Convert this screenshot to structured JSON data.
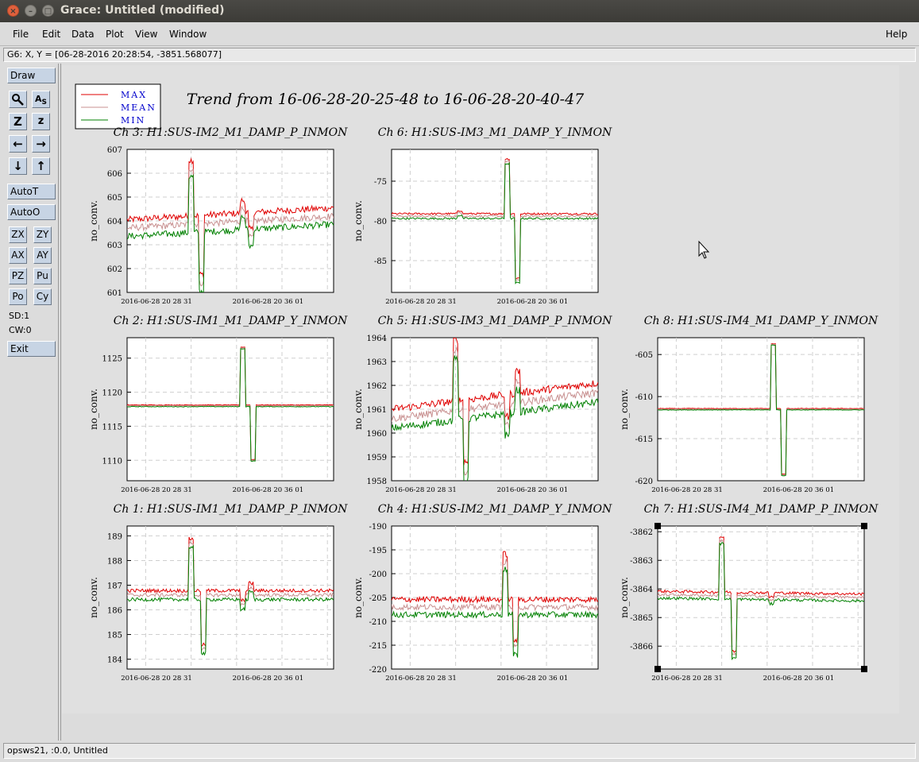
{
  "window": {
    "title": "Grace: Untitled (modified)"
  },
  "menu": {
    "file": "File",
    "edit": "Edit",
    "data": "Data",
    "plot": "Plot",
    "view": "View",
    "window": "Window",
    "help": "Help"
  },
  "coord_readout": "G6: X, Y = [06-28-2016 20:28:54, -3851.568077]",
  "tools": {
    "draw": "Draw",
    "autot": "AutoT",
    "autoo": "AutoO",
    "zx": "ZX",
    "zy": "ZY",
    "ax": "AX",
    "ay": "AY",
    "pz": "PZ",
    "pu": "Pu",
    "po": "Po",
    "cy": "Cy",
    "sd": "SD:1",
    "cw": "CW:0",
    "exit": "Exit",
    "icons": [
      "zoom-icon",
      "text-icon",
      "autoscale-z-icon",
      "zoom-z-icon",
      "left-arrow-icon",
      "right-arrow-icon",
      "down-arrow-icon",
      "up-arrow-icon"
    ]
  },
  "status": "opsws21, :0.0, Untitled",
  "plot_title": "Trend from 16-06-28-20-25-48 to 16-06-28-20-40-47",
  "legend": [
    "MAX",
    "MEAN",
    "MIN"
  ],
  "colors": {
    "max": "#e00000",
    "mean": "#c89090",
    "min": "#008000",
    "legend_text": "#0000cc"
  },
  "chart_data": [
    {
      "type": "line",
      "title": "Ch 3: H1:SUS-IM2_M1_DAMP_P_INMON",
      "ylabel": "no_conv.",
      "ylim": [
        601,
        607
      ],
      "yticks": [
        "601",
        "602",
        "603",
        "604",
        "605",
        "606",
        "607"
      ],
      "xticks": [
        "2016-06-28 20 28 31",
        "2016-06-28 20 36 01"
      ],
      "shape": "drift_spike",
      "base": [
        603.7,
        604.2
      ],
      "spread": [
        0.35,
        0.25
      ],
      "events": [
        {
          "t": 0.31,
          "v": 606.2
        },
        {
          "t": 0.36,
          "v": 601.4
        },
        {
          "t": 0.56,
          "v": 604.5
        },
        {
          "t": 0.6,
          "v": 603.3
        }
      ],
      "series": [
        {
          "name": "MAX"
        },
        {
          "name": "MEAN"
        },
        {
          "name": "MIN"
        }
      ]
    },
    {
      "type": "line",
      "title": "Ch 6: H1:SUS-IM3_M1_DAMP_Y_INMON",
      "ylabel": "no_conv.",
      "ylim": [
        -89,
        -71
      ],
      "yticks": [
        "-75",
        "-80",
        "-85"
      ],
      "yvals": [
        -75,
        -80,
        -85
      ],
      "xticks": [
        "2016-06-28 20 28 31",
        "2016-06-28 20 36 01"
      ],
      "shape": "flat_spike",
      "base": [
        -79.4,
        -79.4
      ],
      "spread": [
        0.3,
        0.2
      ],
      "events": [
        {
          "t": 0.33,
          "v": -79.0
        },
        {
          "t": 0.56,
          "v": -72.5
        },
        {
          "t": 0.61,
          "v": -87.5
        }
      ],
      "series": [
        {
          "name": "MAX"
        },
        {
          "name": "MEAN"
        },
        {
          "name": "MIN"
        }
      ]
    },
    {
      "type": "line",
      "title": "Ch 2: H1:SUS-IM1_M1_DAMP_Y_INMON",
      "ylabel": "no_conv.",
      "ylim": [
        1107,
        1128
      ],
      "yticks": [
        "1110",
        "1115",
        "1120",
        "1125"
      ],
      "yvals": [
        1110,
        1115,
        1120,
        1125
      ],
      "xticks": [
        "2016-06-28 20 28 31",
        "2016-06-28 20 36 01"
      ],
      "shape": "flat_spike",
      "base": [
        1118,
        1118
      ],
      "spread": [
        0.12,
        0.08
      ],
      "events": [
        {
          "t": 0.56,
          "v": 1126.5
        },
        {
          "t": 0.61,
          "v": 1110
        }
      ],
      "series": [
        {
          "name": "MAX"
        },
        {
          "name": "MEAN"
        },
        {
          "name": "MIN"
        }
      ]
    },
    {
      "type": "line",
      "title": "Ch 5: H1:SUS-IM3_M1_DAMP_P_INMON",
      "ylabel": "no_conv.",
      "ylim": [
        1958,
        1964
      ],
      "yticks": [
        "1958",
        "1959",
        "1960",
        "1961",
        "1962",
        "1963",
        "1964"
      ],
      "xticks": [
        "2016-06-28 20 28 31",
        "2016-06-28 20 36 01"
      ],
      "shape": "drift_spike",
      "base": [
        1960.6,
        1961.7
      ],
      "spread": [
        0.4,
        0.3
      ],
      "events": [
        {
          "t": 0.31,
          "v": 1963.5
        },
        {
          "t": 0.36,
          "v": 1958.4
        },
        {
          "t": 0.56,
          "v": 1960.3
        },
        {
          "t": 0.61,
          "v": 1962.2
        }
      ],
      "series": [
        {
          "name": "MAX"
        },
        {
          "name": "MEAN"
        },
        {
          "name": "MIN"
        }
      ]
    },
    {
      "type": "line",
      "title": "Ch 8: H1:SUS-IM4_M1_DAMP_Y_INMON",
      "ylabel": "no_conv.",
      "ylim": [
        -620,
        -603
      ],
      "yticks": [
        "-605",
        "-610",
        "-615",
        "-620"
      ],
      "yvals": [
        -605,
        -610,
        -615,
        -620
      ],
      "xticks": [
        "2016-06-28 20 28 31",
        "2016-06-28 20 36 01"
      ],
      "shape": "flat_spike",
      "base": [
        -611.5,
        -611.5
      ],
      "spread": [
        0.08,
        0.06
      ],
      "events": [
        {
          "t": 0.56,
          "v": -603.8
        },
        {
          "t": 0.61,
          "v": -619.3
        }
      ],
      "series": [
        {
          "name": "MAX"
        },
        {
          "name": "MEAN"
        },
        {
          "name": "MIN"
        }
      ]
    },
    {
      "type": "line",
      "title": "Ch 1: H1:SUS-IM1_M1_DAMP_P_INMON",
      "ylabel": "no_conv.",
      "ylim": [
        183.6,
        189.4
      ],
      "yticks": [
        "184",
        "185",
        "186",
        "187",
        "188",
        "189"
      ],
      "yvals": [
        184,
        185,
        186,
        187,
        188,
        189
      ],
      "xticks": [
        "2016-06-28 20 28 31",
        "2016-06-28 20 36 01"
      ],
      "shape": "flat_spike",
      "base": [
        186.6,
        186.6
      ],
      "spread": [
        0.18,
        0.12
      ],
      "events": [
        {
          "t": 0.31,
          "v": 188.7
        },
        {
          "t": 0.37,
          "v": 184.4
        },
        {
          "t": 0.56,
          "v": 186.2
        },
        {
          "t": 0.6,
          "v": 186.9
        }
      ],
      "series": [
        {
          "name": "MAX"
        },
        {
          "name": "MEAN"
        },
        {
          "name": "MIN"
        }
      ]
    },
    {
      "type": "line",
      "title": "Ch 4: H1:SUS-IM2_M1_DAMP_Y_INMON",
      "ylabel": "no_conv.",
      "ylim": [
        -220,
        -190
      ],
      "yticks": [
        "-190",
        "-195",
        "-200",
        "-205",
        "-210",
        "-215",
        "-220"
      ],
      "yvals": [
        -190,
        -195,
        -200,
        -205,
        -210,
        -215,
        -220
      ],
      "xticks": [
        "2016-06-28 20 28 31",
        "2016-06-28 20 36 01"
      ],
      "shape": "band",
      "base": [
        -207,
        -207
      ],
      "spread": [
        1.6,
        1.2
      ],
      "events": [
        {
          "t": 0.55,
          "v": -197.5
        },
        {
          "t": 0.6,
          "v": -215.5
        }
      ],
      "series": [
        {
          "name": "MAX"
        },
        {
          "name": "MEAN"
        },
        {
          "name": "MIN"
        }
      ]
    },
    {
      "type": "line",
      "title": "Ch 7: H1:SUS-IM4_M1_DAMP_P_INMON",
      "ylabel": "no_conv.",
      "ylim": [
        -3866.8,
        -3861.8
      ],
      "yticks": [
        "-3862",
        "-3863",
        "-3864",
        "-3865",
        "-3866"
      ],
      "yvals": [
        -3862,
        -3863,
        -3864,
        -3865,
        -3866
      ],
      "xticks": [
        "2016-06-28 20 28 31",
        "2016-06-28 20 36 01"
      ],
      "shape": "flat_spike",
      "base": [
        -3864.2,
        -3864.3
      ],
      "spread": [
        0.12,
        0.1
      ],
      "events": [
        {
          "t": 0.31,
          "v": -3862.3
        },
        {
          "t": 0.37,
          "v": -3866.3
        },
        {
          "t": 0.55,
          "v": -3864.4
        }
      ],
      "series": [
        {
          "name": "MAX"
        },
        {
          "name": "MEAN"
        },
        {
          "name": "MIN"
        }
      ]
    }
  ]
}
